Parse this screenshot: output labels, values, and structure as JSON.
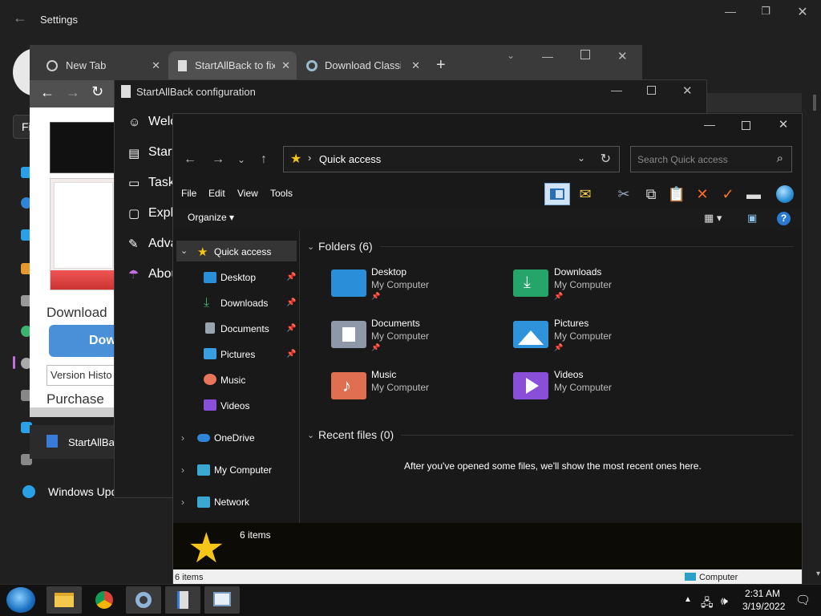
{
  "settings": {
    "title": "Settings",
    "sidebar_visible_label": "Windows Upd",
    "fi_label": "Fi"
  },
  "browser": {
    "tabs": [
      {
        "label": "New Tab"
      },
      {
        "label": "StartAllBack to fix"
      },
      {
        "label": "Download Classic"
      }
    ],
    "page": {
      "download_heading": "Download",
      "download_button": "Dow",
      "version_history": "Version Histo",
      "purchase": "Purchase"
    }
  },
  "startallback": {
    "title": "StartAllBack configuration",
    "items": [
      {
        "label": "Welc",
        "icon": "smile-icon"
      },
      {
        "label": "Start",
        "icon": "start-menu-icon"
      },
      {
        "label": "Taskb",
        "icon": "taskbar-icon"
      },
      {
        "label": "Explo",
        "icon": "folder-icon"
      },
      {
        "label": "Adva",
        "icon": "wrench-icon"
      },
      {
        "label": "Abou",
        "icon": "umbrella-icon"
      }
    ],
    "taskbar_preview": "StartAllBac"
  },
  "explorer": {
    "address": "Quick access",
    "search_placeholder": "Search Quick access",
    "menu": [
      "File",
      "Edit",
      "View",
      "Tools"
    ],
    "organize": "Organize",
    "nav": {
      "quick_access": "Quick access",
      "pinned": [
        {
          "label": "Desktop",
          "color": "#2a8fd8"
        },
        {
          "label": "Downloads",
          "color": "#3cb371"
        },
        {
          "label": "Documents",
          "color": "#9aa4b0"
        },
        {
          "label": "Pictures",
          "color": "#3a9ee0"
        }
      ],
      "unpinned": [
        {
          "label": "Music",
          "color": "#e8745a"
        },
        {
          "label": "Videos",
          "color": "#8a4fd8"
        }
      ],
      "roots": [
        {
          "label": "OneDrive",
          "color": "#2f86d8"
        },
        {
          "label": "My Computer",
          "color": "#3aa8d0"
        },
        {
          "label": "Network",
          "color": "#3aa8d0"
        }
      ]
    },
    "folders_header": "Folders (6)",
    "folders": [
      {
        "name": "Desktop",
        "sub": "My Computer",
        "pinned": true,
        "color": "#2a8fd8"
      },
      {
        "name": "Downloads",
        "sub": "My Computer",
        "pinned": true,
        "color": "#25a56a"
      },
      {
        "name": "Documents",
        "sub": "My Computer",
        "pinned": true,
        "color": "#8e98a8"
      },
      {
        "name": "Pictures",
        "sub": "My Computer",
        "pinned": true,
        "color": "#2f93dc"
      },
      {
        "name": "Music",
        "sub": "My Computer",
        "pinned": false,
        "color": "#e06e50"
      },
      {
        "name": "Videos",
        "sub": "My Computer",
        "pinned": false,
        "color": "#8a4fd8"
      }
    ],
    "recent_header": "Recent files (0)",
    "recent_message": "After you've opened some files, we'll show the most recent ones here.",
    "details_count": "6 items",
    "status_left": "6 items",
    "status_right": "Computer"
  },
  "taskbar": {
    "time": "2:31 AM",
    "date": "3/19/2022"
  }
}
